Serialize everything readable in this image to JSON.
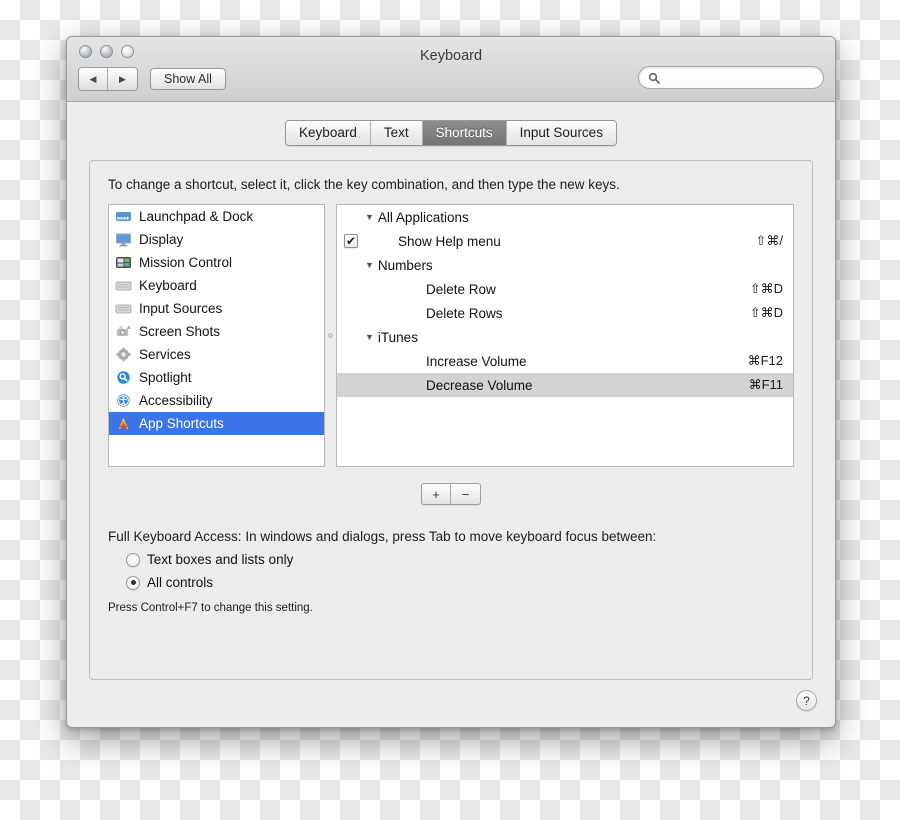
{
  "window": {
    "title": "Keyboard",
    "traffic_lights": [
      "close-button",
      "minimize-button",
      "zoom-button"
    ],
    "show_all_label": "Show All",
    "back_glyph": "◀",
    "forward_glyph": "▶",
    "search": {
      "value": "",
      "placeholder": "",
      "icon": "search-icon"
    }
  },
  "tabs": [
    {
      "label": "Keyboard",
      "active": false
    },
    {
      "label": "Text",
      "active": false
    },
    {
      "label": "Shortcuts",
      "active": true
    },
    {
      "label": "Input Sources",
      "active": false
    }
  ],
  "instruction": "To change a shortcut, select it, click the key combination, and then type the new keys.",
  "sidebar": {
    "items": [
      {
        "label": "Launchpad & Dock",
        "icon": "launchpad-dock-icon",
        "selected": false
      },
      {
        "label": "Display",
        "icon": "display-icon",
        "selected": false
      },
      {
        "label": "Mission Control",
        "icon": "mission-control-icon",
        "selected": false
      },
      {
        "label": "Keyboard",
        "icon": "keyboard-icon",
        "selected": false
      },
      {
        "label": "Input Sources",
        "icon": "input-sources-icon",
        "selected": false
      },
      {
        "label": "Screen Shots",
        "icon": "screen-shots-icon",
        "selected": false
      },
      {
        "label": "Services",
        "icon": "services-gear-icon",
        "selected": false
      },
      {
        "label": "Spotlight",
        "icon": "spotlight-icon",
        "selected": false
      },
      {
        "label": "Accessibility",
        "icon": "accessibility-icon",
        "selected": false
      },
      {
        "label": "App Shortcuts",
        "icon": "app-shortcuts-icon",
        "selected": true
      }
    ],
    "selection_color": "#3a74e8"
  },
  "shortcuts_tree": {
    "disclosure_glyph": "▼",
    "rows": [
      {
        "type": "group",
        "label": "All Applications",
        "expanded": true
      },
      {
        "type": "item",
        "label": "Show Help menu",
        "key": "⇧⌘/",
        "checked": true,
        "selected": false
      },
      {
        "type": "group",
        "label": "Numbers",
        "expanded": true
      },
      {
        "type": "item",
        "label": "Delete Row",
        "key": "⇧⌘D",
        "checked": false,
        "selected": false
      },
      {
        "type": "item",
        "label": "Delete Rows",
        "key": "⇧⌘D",
        "checked": false,
        "selected": false
      },
      {
        "type": "group",
        "label": "iTunes",
        "expanded": true
      },
      {
        "type": "item",
        "label": "Increase Volume",
        "key": "⌘F12",
        "checked": false,
        "selected": false
      },
      {
        "type": "item",
        "label": "Decrease Volume",
        "key": "⌘F11",
        "checked": false,
        "selected": true
      }
    ],
    "selection_color": "#d3d3d3",
    "checkmark_glyph": "✔"
  },
  "list_buttons": {
    "add_label": "+",
    "remove_label": "−"
  },
  "full_keyboard_access": {
    "description": "Full Keyboard Access: In windows and dialogs, press Tab to move keyboard focus between:",
    "options": [
      {
        "label": "Text boxes and lists only",
        "selected": false
      },
      {
        "label": "All controls",
        "selected": true
      }
    ],
    "note": "Press Control+F7 to change this setting."
  },
  "help_button": {
    "label": "?"
  }
}
